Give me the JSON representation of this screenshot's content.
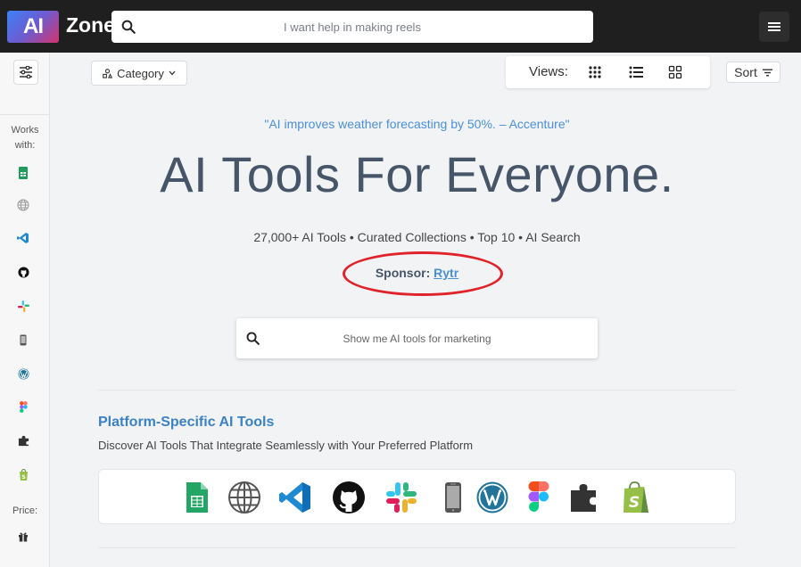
{
  "header": {
    "logo_mark": "AI",
    "logo_text": "Zones",
    "search_placeholder": "I want help in making reels"
  },
  "sidebar": {
    "works_with_label_1": "Works",
    "works_with_label_2": "with:",
    "price_label": "Price:",
    "platform_icons": [
      "google-sheets-icon",
      "globe-icon",
      "vscode-icon",
      "github-icon",
      "slack-icon",
      "mobile-icon",
      "wordpress-icon",
      "figma-icon",
      "puzzle-icon",
      "shopify-icon"
    ],
    "price_icons": [
      "gift-icon"
    ]
  },
  "toolbar": {
    "category_label": "Category",
    "views_label": "Views:",
    "sort_label": "Sort"
  },
  "hero": {
    "quote": "\"AI improves weather forecasting by 50%. – Accenture\"",
    "title": "AI Tools For Everyone.",
    "stats": "27,000+ AI Tools • Curated Collections • Top 10 • AI Search",
    "sponsor_label": "Sponsor:",
    "sponsor_name": "Rytr"
  },
  "main_search": {
    "placeholder": "Show me AI tools for marketing"
  },
  "platform_section": {
    "title": "Platform-Specific AI Tools",
    "subtitle": "Discover AI Tools That Integrate Seamlessly with Your Preferred Platform"
  },
  "colors": {
    "topbar": "#1f1f1f",
    "accent": "#4a90d9",
    "highlight_ring": "#e0222a"
  }
}
